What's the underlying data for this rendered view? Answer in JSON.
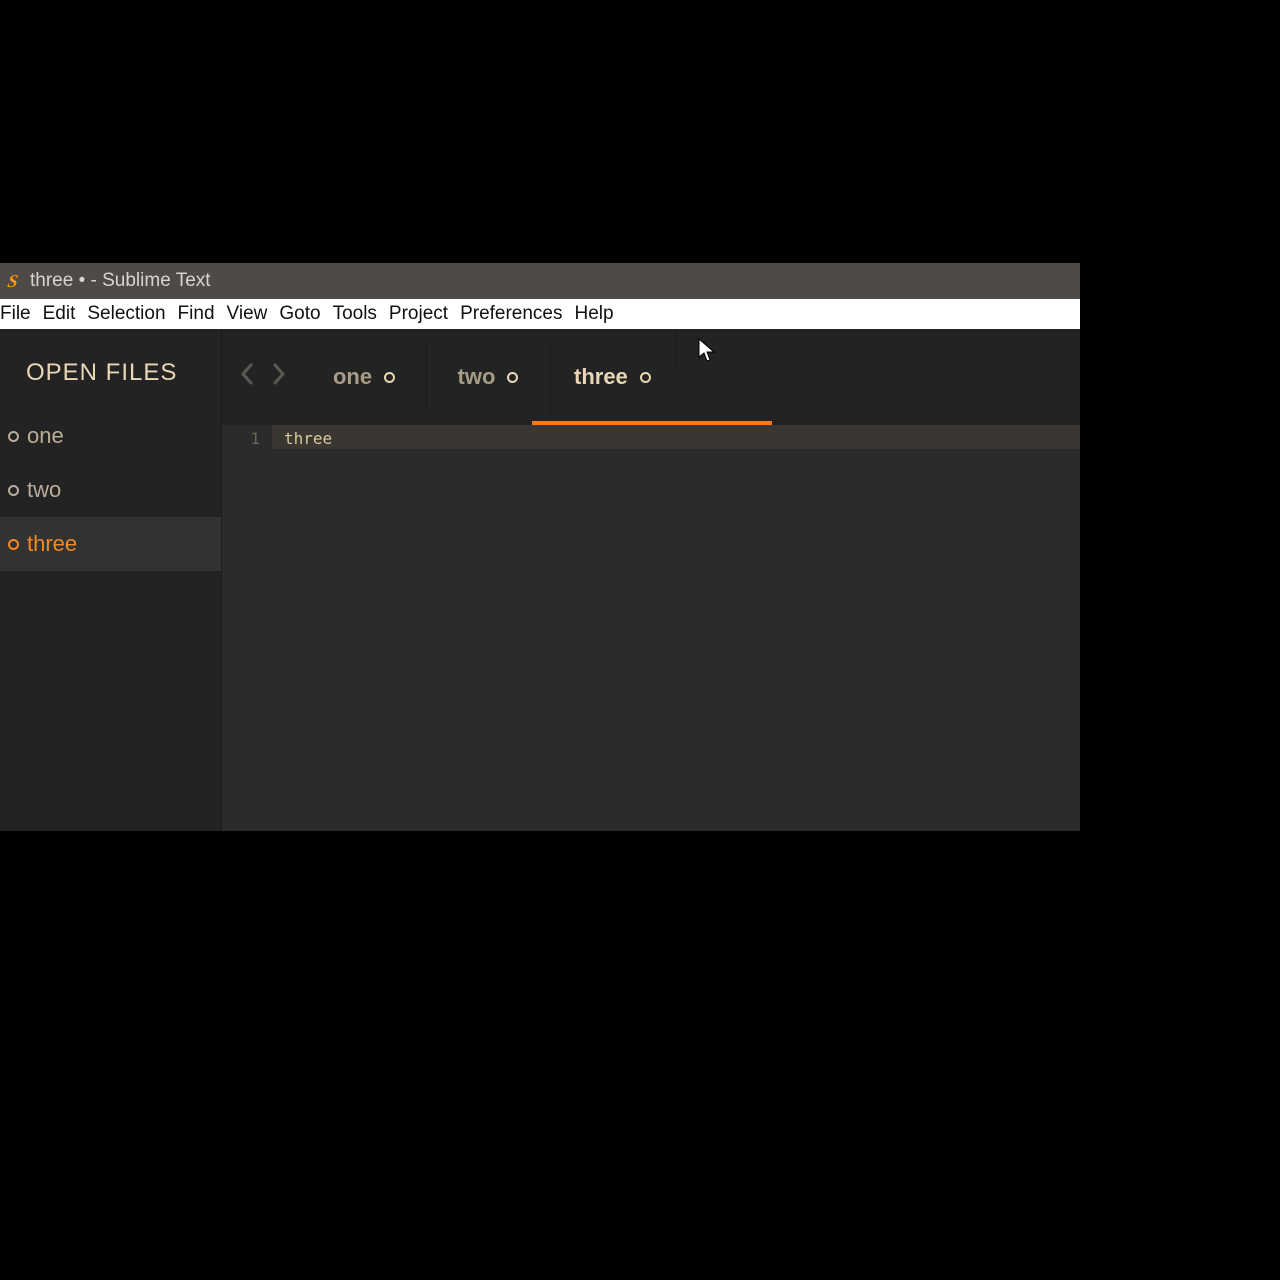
{
  "window": {
    "title": "three • - Sublime Text"
  },
  "menubar": {
    "items": [
      "File",
      "Edit",
      "Selection",
      "Find",
      "View",
      "Goto",
      "Tools",
      "Project",
      "Preferences",
      "Help"
    ]
  },
  "sidebar": {
    "title": "OPEN FILES",
    "items": [
      {
        "label": "one",
        "active": false
      },
      {
        "label": "two",
        "active": false
      },
      {
        "label": "three",
        "active": true
      }
    ]
  },
  "tabs": {
    "nav": {
      "back_enabled": false,
      "forward_enabled": false
    },
    "items": [
      {
        "label": "one",
        "dirty": true,
        "active": false
      },
      {
        "label": "two",
        "dirty": true,
        "active": false
      },
      {
        "label": "three",
        "dirty": true,
        "active": true
      }
    ]
  },
  "editor": {
    "gutter": {
      "line1": "1"
    },
    "content": {
      "line1": "three"
    }
  }
}
